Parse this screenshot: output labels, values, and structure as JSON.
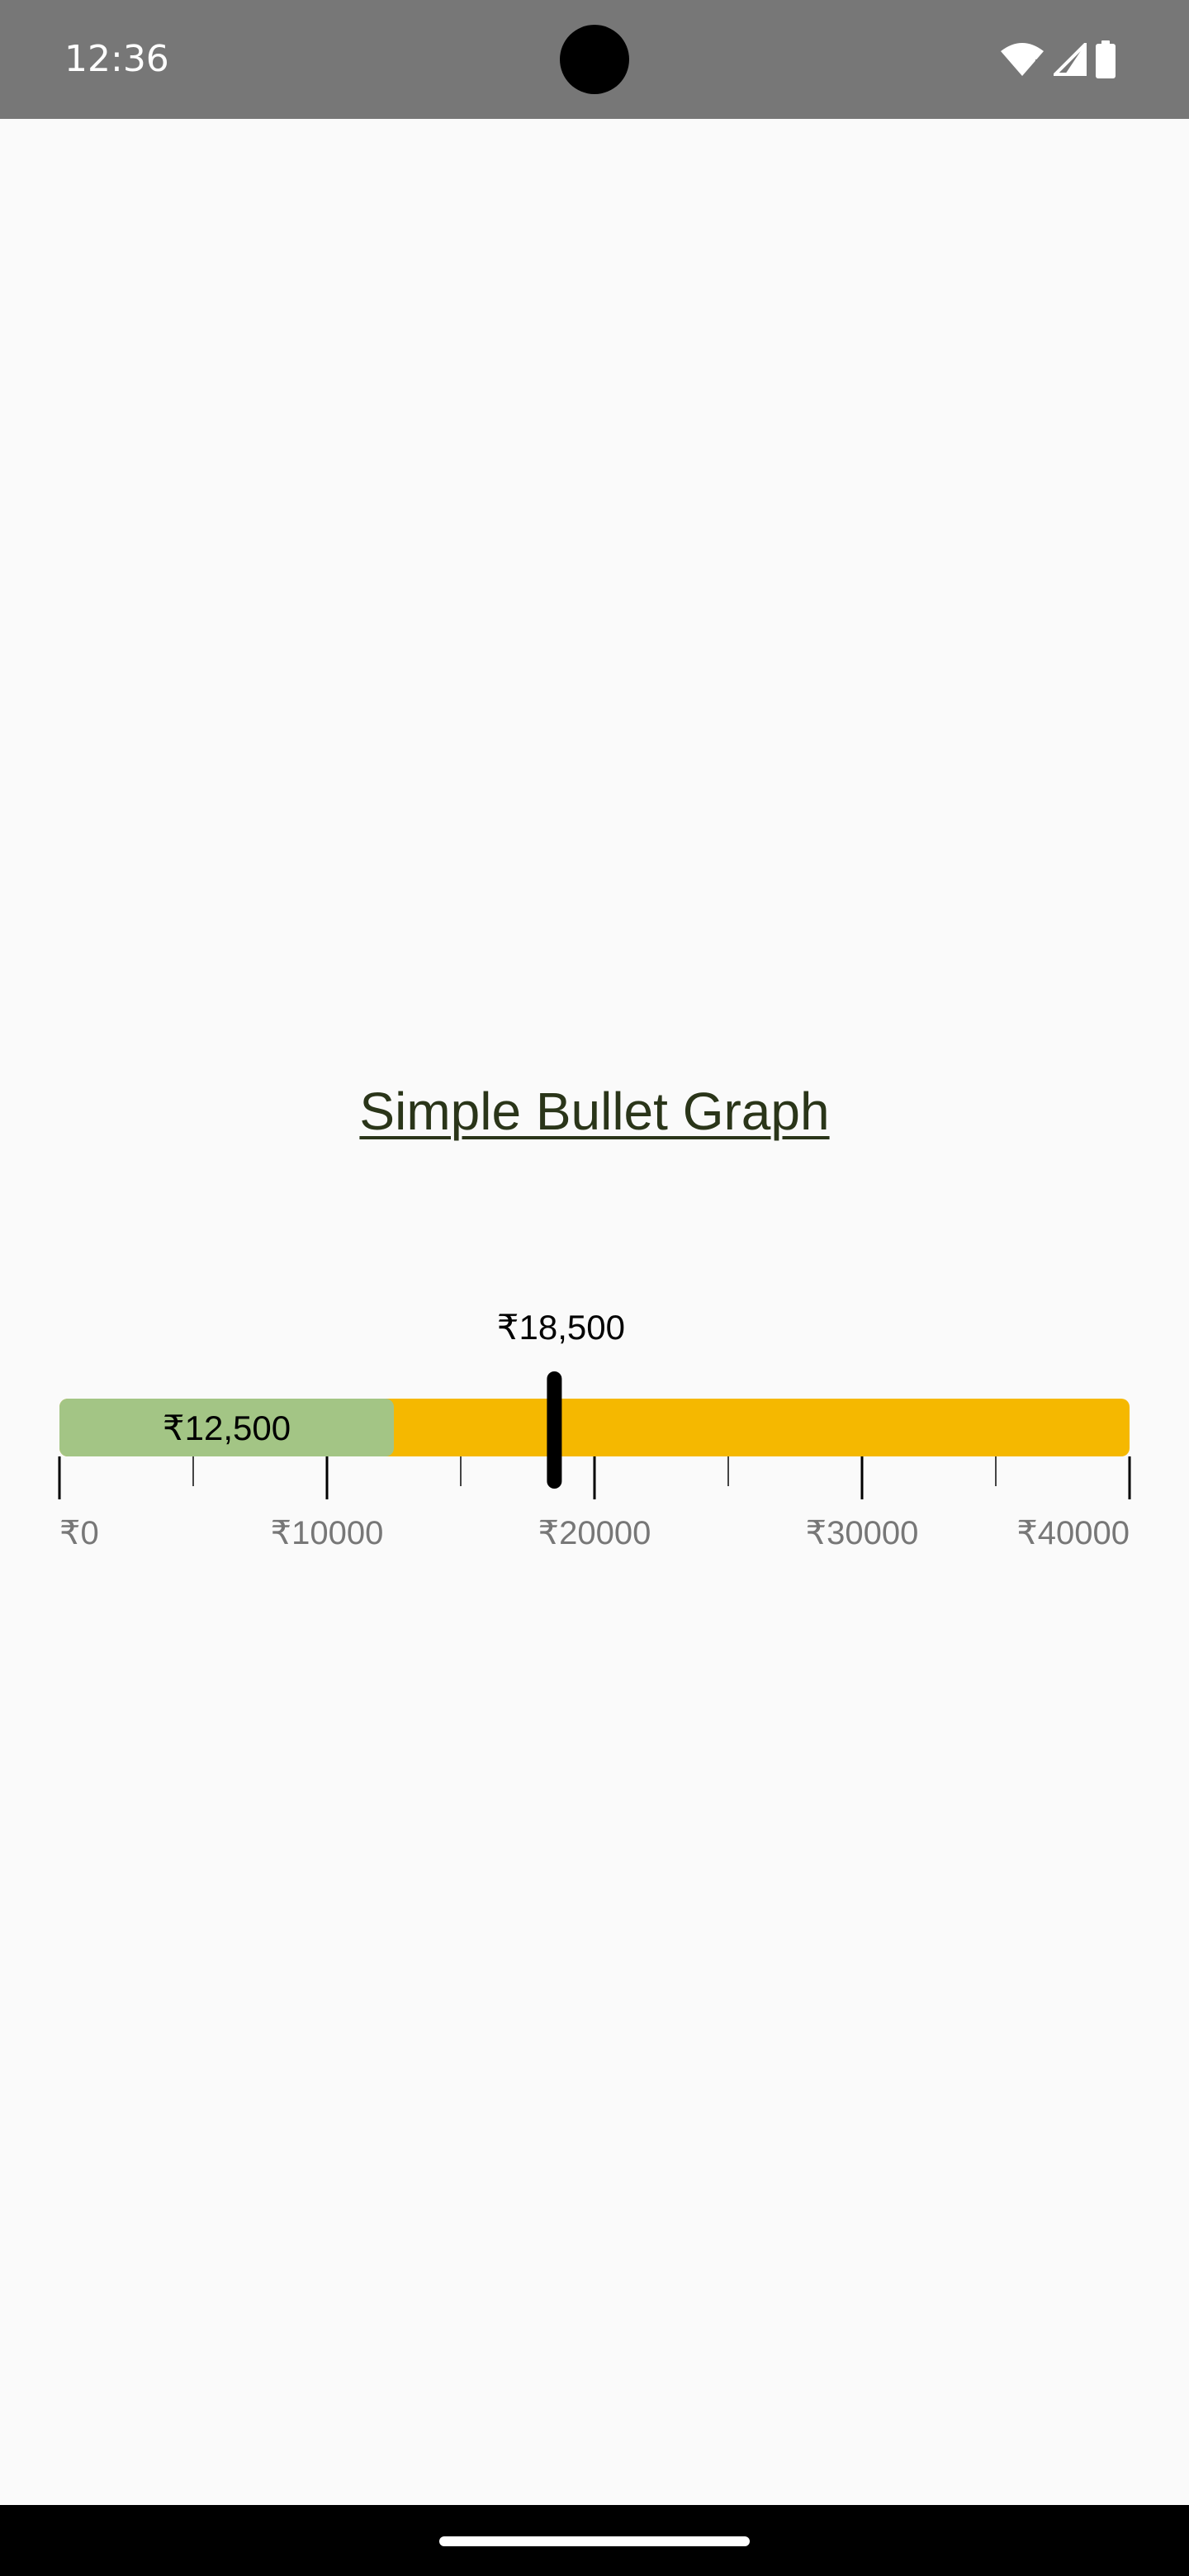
{
  "status_bar": {
    "time": "12:36",
    "icons": [
      "wifi-icon",
      "signal-icon",
      "battery-icon"
    ]
  },
  "page": {
    "title": "Simple Bullet Graph"
  },
  "chart_data": {
    "type": "bullet",
    "title": "Simple Bullet Graph",
    "min": 0,
    "max": 40000,
    "currency": "₹",
    "value": 12500,
    "value_label": "₹12,500",
    "target": 18500,
    "target_label": "₹18,500",
    "ranges": [
      {
        "from": 0,
        "to": 40000,
        "color": "#f5b800"
      }
    ],
    "bar_color": "#a3c585",
    "target_color": "#000000",
    "major_ticks": [
      0,
      10000,
      20000,
      30000,
      40000
    ],
    "minor_ticks": [
      5000,
      15000,
      25000,
      35000
    ],
    "tick_labels": [
      "₹0",
      "₹10000",
      "₹20000",
      "₹30000",
      "₹40000"
    ]
  }
}
